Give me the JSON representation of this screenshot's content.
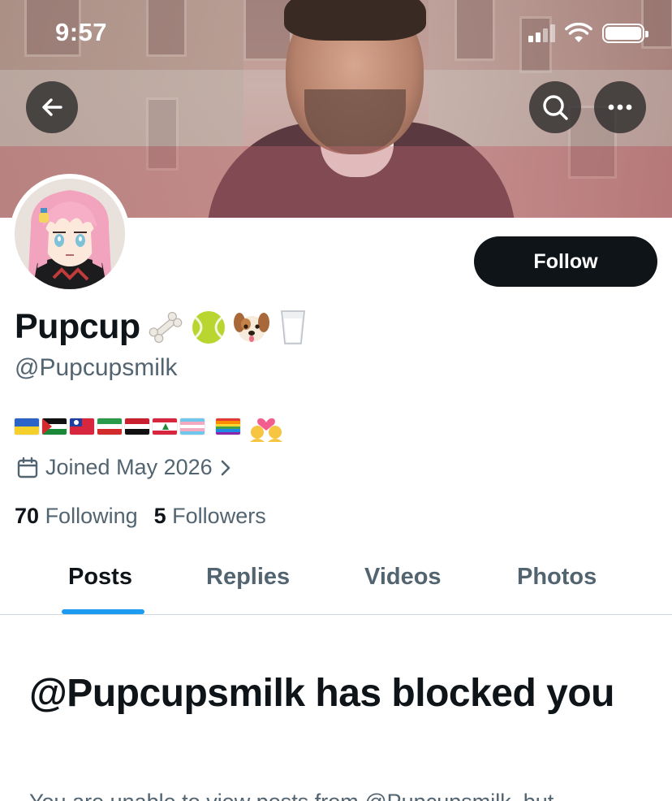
{
  "status_bar": {
    "time": "9:57"
  },
  "profile": {
    "display_name": "Pupcup",
    "name_emojis": [
      "bone-emoji",
      "tennis-ball-emoji",
      "dog-face-emoji",
      "milk-glass-emoji"
    ],
    "handle": "@Pupcupsmilk",
    "bio_flags": [
      "ukraine-flag",
      "palestine-flag",
      "taiwan-flag",
      "iran-flag",
      "egypt-flag",
      "lebanon-flag",
      "transgender-flag",
      "rainbow-flag",
      "couple-with-heart-emoji"
    ],
    "joined": "Joined May 2026",
    "following_count": "70",
    "following_label": "Following",
    "followers_count": "5",
    "followers_label": "Followers"
  },
  "follow_button": {
    "label": "Follow"
  },
  "tabs": [
    {
      "label": "Posts",
      "active": true
    },
    {
      "label": "Replies",
      "active": false
    },
    {
      "label": "Videos",
      "active": false
    },
    {
      "label": "Photos",
      "active": false
    }
  ],
  "blocked": {
    "title": "@Pupcupsmilk has blocked you",
    "subtitle": "You are unable to view posts from @Pupcupsmilk, but"
  },
  "colors": {
    "accent": "#1d9bf0",
    "text_primary": "#0f1419",
    "text_secondary": "#536471",
    "follow_bg": "#0f1419"
  },
  "icons": {
    "back": "arrow-left-icon",
    "search": "search-icon",
    "more": "more-horizontal-icon",
    "calendar": "calendar-icon",
    "chevron": "chevron-right-icon"
  }
}
